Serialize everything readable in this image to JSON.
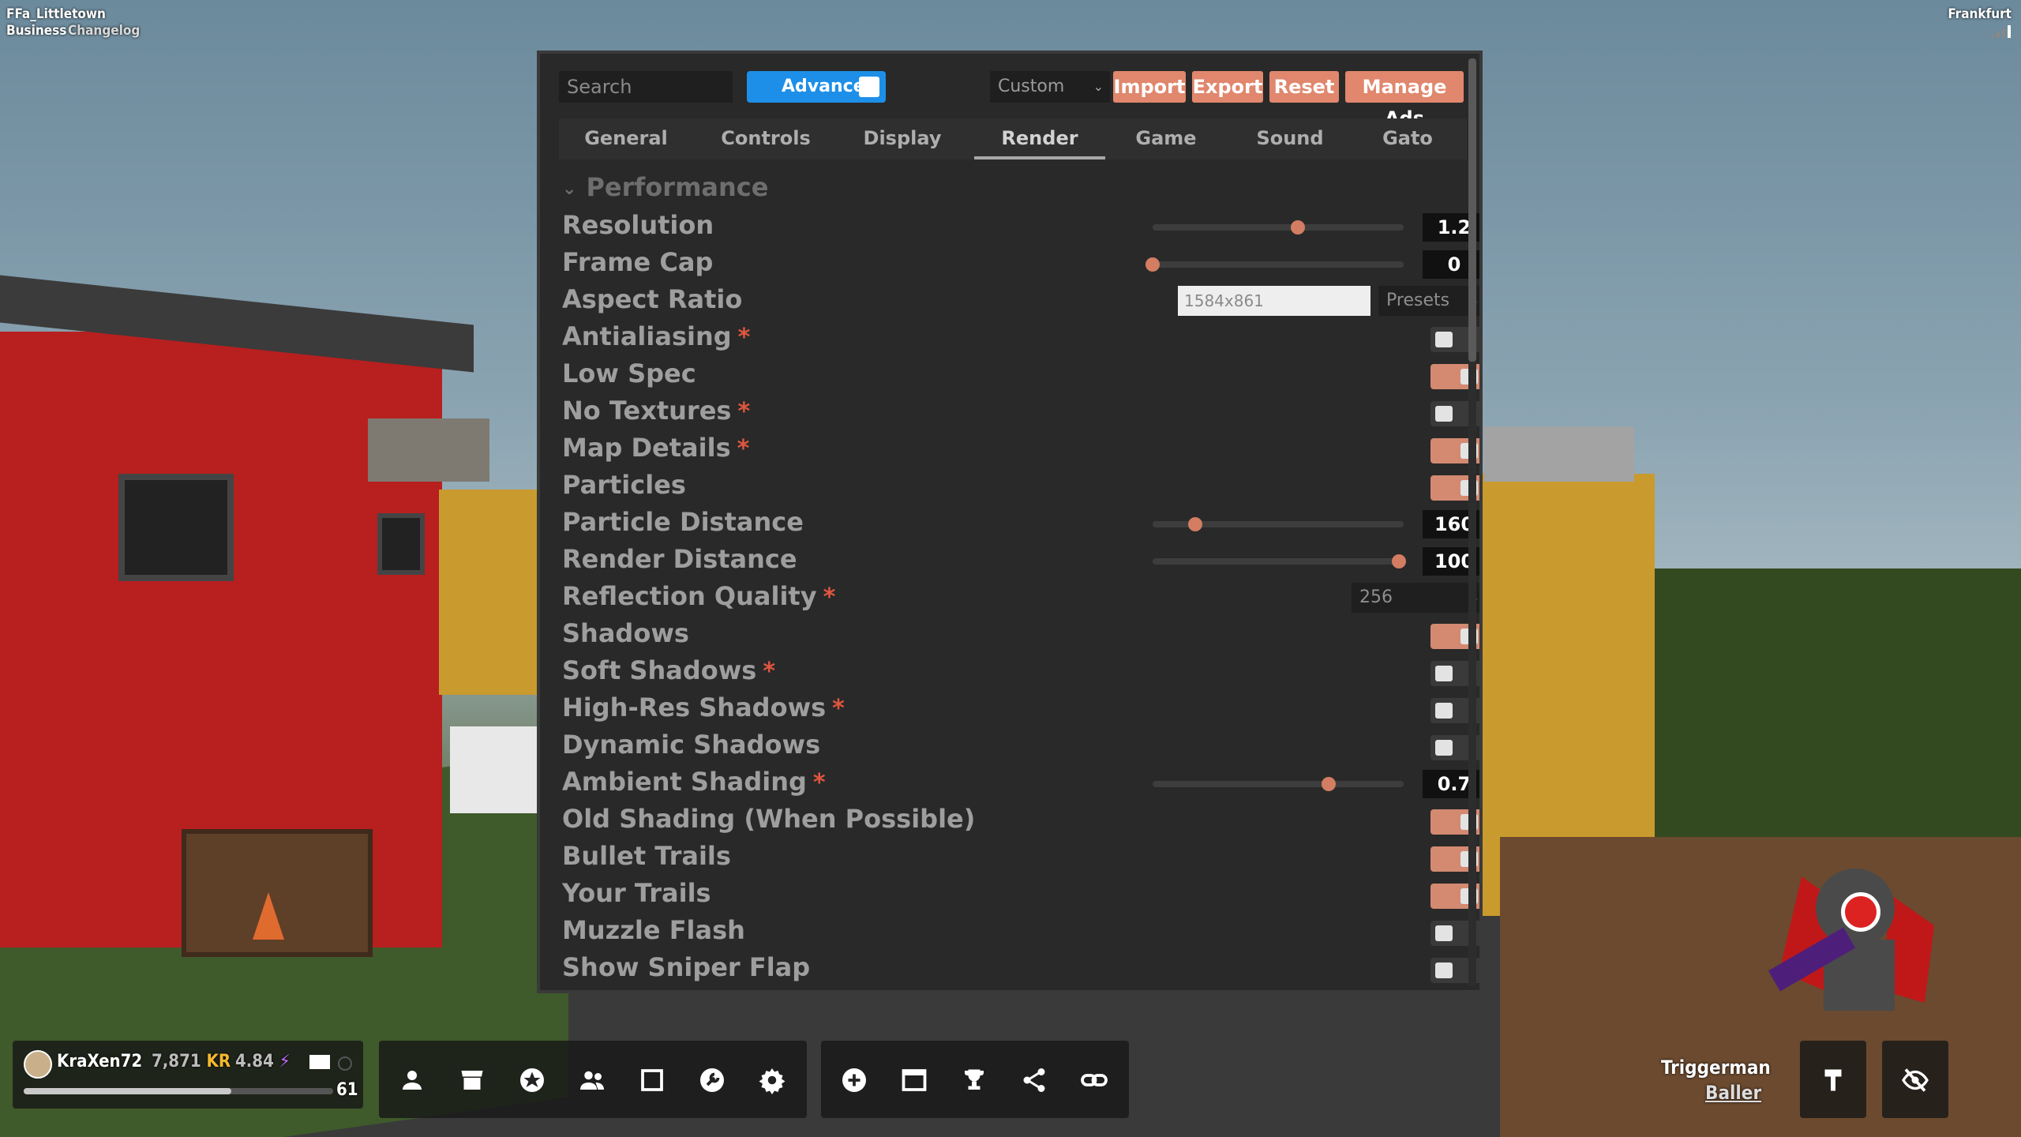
{
  "hud": {
    "map_name": "FFa_Littletown",
    "links": [
      "Business",
      "Changelog"
    ],
    "region": "Frankfurt",
    "player": {
      "name": "KraXen72",
      "kr_value": "7,871",
      "kr_unit": "KR",
      "stat_value": "4.84",
      "level": "61",
      "level_progress": 0.67
    },
    "character_name": "Triggerman",
    "character_class": "Baller"
  },
  "settings": {
    "search_placeholder": "Search",
    "advanced_label": "Advanced",
    "advanced_on": true,
    "preset_value": "Custom",
    "buttons": [
      "Import",
      "Export",
      "Reset",
      "Manage Ads"
    ],
    "tabs": [
      "General",
      "Controls",
      "Display",
      "Render",
      "Game",
      "Sound",
      "Gato"
    ],
    "active_tab": "Render",
    "section": "Performance",
    "rows": [
      {
        "label": "Resolution",
        "type": "slider",
        "value": "1.2",
        "fraction": 0.58,
        "required": false
      },
      {
        "label": "Frame Cap",
        "type": "slider",
        "value": "0",
        "fraction": 0.0,
        "required": false
      },
      {
        "label": "Aspect Ratio",
        "type": "text",
        "value": "1584x861",
        "select": "Presets",
        "required": false
      },
      {
        "label": "Antialiasing",
        "type": "toggle",
        "on": false,
        "required": true
      },
      {
        "label": "Low Spec",
        "type": "toggle",
        "on": true,
        "required": false
      },
      {
        "label": "No Textures",
        "type": "toggle",
        "on": false,
        "required": true
      },
      {
        "label": "Map Details",
        "type": "toggle",
        "on": true,
        "required": true
      },
      {
        "label": "Particles",
        "type": "toggle",
        "on": true,
        "required": false
      },
      {
        "label": "Particle Distance",
        "type": "slider",
        "value": "160",
        "fraction": 0.17,
        "required": false
      },
      {
        "label": "Render Distance",
        "type": "slider",
        "value": "100",
        "fraction": 0.98,
        "required": false
      },
      {
        "label": "Reflection Quality",
        "type": "select",
        "value": "256",
        "required": true
      },
      {
        "label": "Shadows",
        "type": "toggle",
        "on": true,
        "required": false
      },
      {
        "label": "Soft Shadows",
        "type": "toggle",
        "on": false,
        "required": true
      },
      {
        "label": "High-Res Shadows",
        "type": "toggle",
        "on": false,
        "required": true
      },
      {
        "label": "Dynamic Shadows",
        "type": "toggle",
        "on": false,
        "required": false
      },
      {
        "label": "Ambient Shading",
        "type": "slider",
        "value": "0.7",
        "fraction": 0.7,
        "required": true
      },
      {
        "label": "Old Shading (When Possible)",
        "type": "toggle",
        "on": true,
        "required": false
      },
      {
        "label": "Bullet Trails",
        "type": "toggle",
        "on": true,
        "required": false
      },
      {
        "label": "Your Trails",
        "type": "toggle",
        "on": true,
        "required": false
      },
      {
        "label": "Muzzle Flash",
        "type": "toggle",
        "on": false,
        "required": false
      },
      {
        "label": "Show Sniper Flap",
        "type": "toggle",
        "on": false,
        "required": false
      }
    ]
  },
  "colors": {
    "accent": "#e0876d",
    "toggle_on": "#d38a71",
    "advanced_blue": "#1d8fe8",
    "kr_gold": "#f5b92e",
    "stat_purple": "#c66bff",
    "required_red": "#e0563f"
  },
  "icons": {
    "menu_group_1": [
      "profile-icon",
      "shop-icon",
      "star-icon",
      "friends-icon",
      "square-icon",
      "wrench-icon",
      "gear-icon"
    ],
    "menu_group_2": [
      "plus-icon",
      "window-icon",
      "trophy-icon",
      "share-icon",
      "link-icon"
    ],
    "right": [
      "hammer-icon",
      "hide-icon"
    ]
  }
}
